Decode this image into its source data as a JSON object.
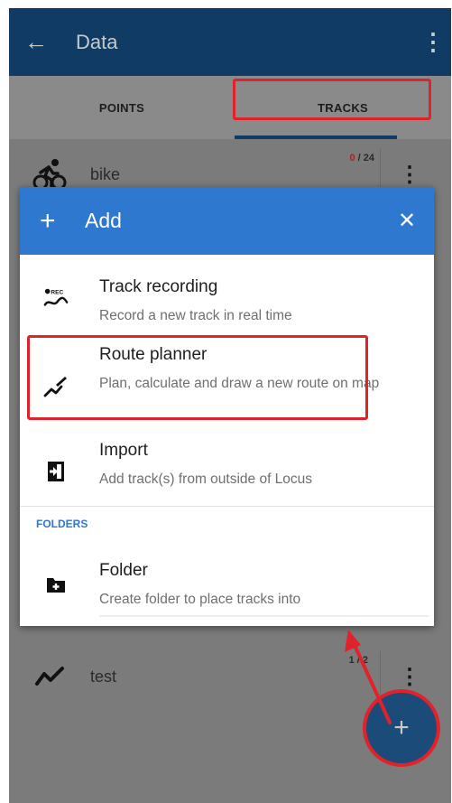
{
  "app_bar": {
    "title": "Data",
    "back_icon": "arrow-back-icon",
    "menu_icon": "more-vert-icon"
  },
  "tabs": [
    {
      "label": "POINTS"
    },
    {
      "label": "TRACKS",
      "selected": true
    }
  ],
  "track_list": [
    {
      "name": "bike",
      "icon": "bike-icon",
      "count_zero": "0",
      "count_rest": " / 24"
    },
    {
      "name": "test",
      "icon": "track-line-icon",
      "count_zero": "",
      "count_rest": "1 / 2"
    }
  ],
  "dialog": {
    "title": "Add",
    "header_icon": "plus-icon",
    "close_icon": "close-icon",
    "items": [
      {
        "title": "Track recording",
        "subtitle": "Record a new track in real time",
        "icon": "rec-track-icon",
        "icon_label": "REC"
      },
      {
        "title": "Route planner",
        "subtitle": "Plan, calculate and draw a new route on map",
        "icon": "route-planner-icon"
      },
      {
        "title": "Import",
        "subtitle": "Add track(s) from outside of Locus",
        "icon": "import-icon"
      }
    ],
    "section_label": "FOLDERS",
    "folder_item": {
      "title": "Folder",
      "subtitle": "Create folder to place tracks into",
      "icon": "add-folder-icon"
    }
  },
  "fab": {
    "icon": "plus-icon",
    "label": "+"
  },
  "colors": {
    "toolbar": "#0f3b64",
    "dialog_header": "#2f78d0",
    "highlight": "#e2222a",
    "scrim": "#7b7b7b",
    "zero_count": "#b31f1f"
  }
}
